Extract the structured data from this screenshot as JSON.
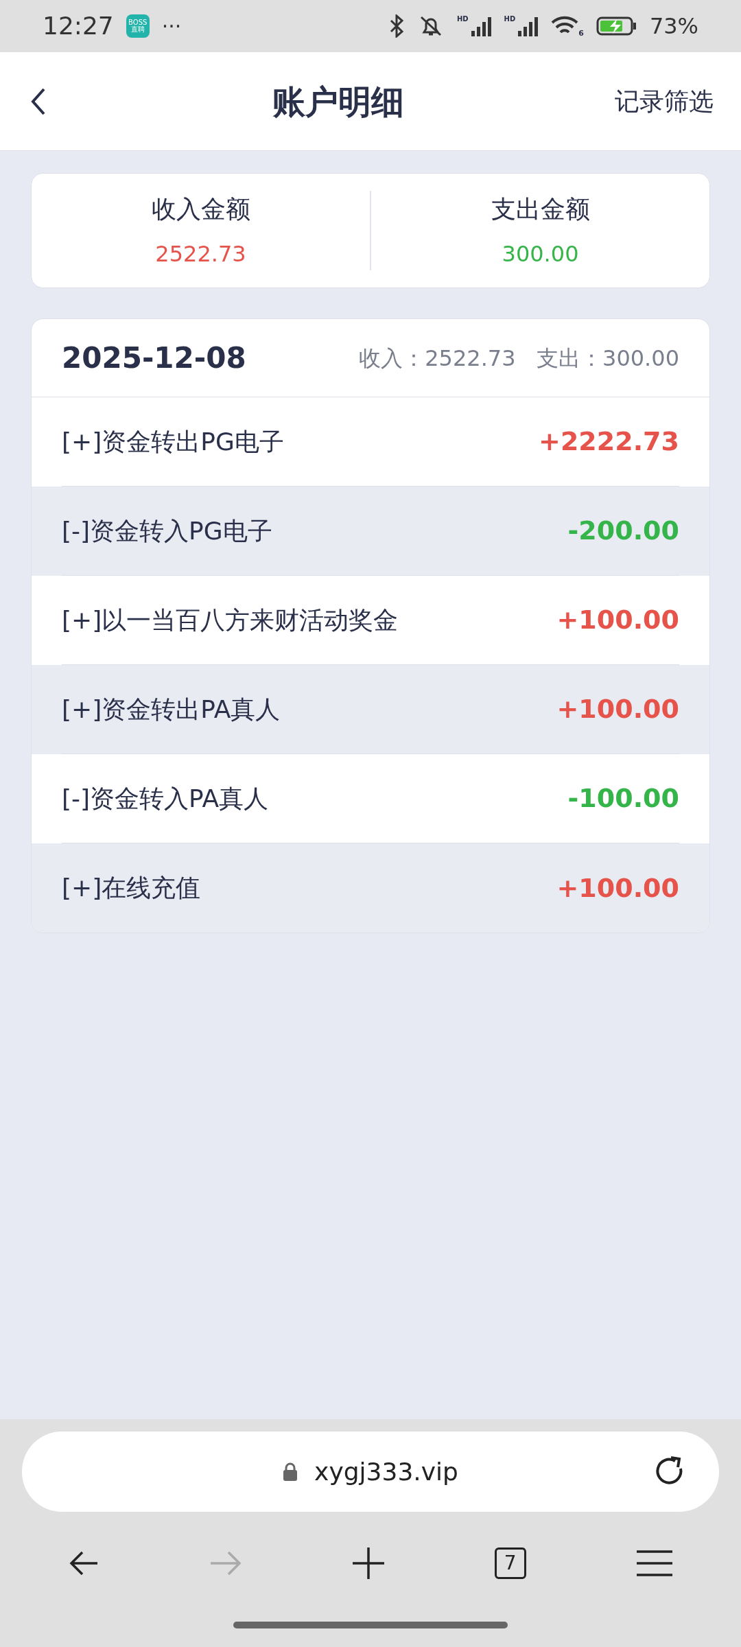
{
  "status_bar": {
    "time": "12:27",
    "app_badge": [
      "BOSS",
      "直聘"
    ],
    "more": "···",
    "signal_labels": [
      "HD",
      "HD"
    ],
    "wifi_label": "6",
    "battery": "73%"
  },
  "header": {
    "title": "账户明细",
    "action": "记录筛选"
  },
  "summary": [
    {
      "label": "收入金额",
      "value": "2522.73",
      "kind": "income"
    },
    {
      "label": "支出金额",
      "value": "300.00",
      "kind": "expense"
    }
  ],
  "day": {
    "date": "2025-12-08",
    "totals": "收入：2522.73   支出：300.00",
    "rows": [
      {
        "title": "[+]资金转出PG电子",
        "amount": "+2222.73",
        "kind": "income"
      },
      {
        "title": "[-]资金转入PG电子",
        "amount": "-200.00",
        "kind": "expense"
      },
      {
        "title": "[+]以一当百八方来财活动奖金",
        "amount": "+100.00",
        "kind": "income"
      },
      {
        "title": "[+]资金转出PA真人",
        "amount": "+100.00",
        "kind": "income"
      },
      {
        "title": "[-]资金转入PA真人",
        "amount": "-100.00",
        "kind": "expense"
      },
      {
        "title": "[+]在线充值",
        "amount": "+100.00",
        "kind": "income"
      }
    ]
  },
  "browser": {
    "url": "xygj333.vip",
    "tab_count": "7"
  }
}
